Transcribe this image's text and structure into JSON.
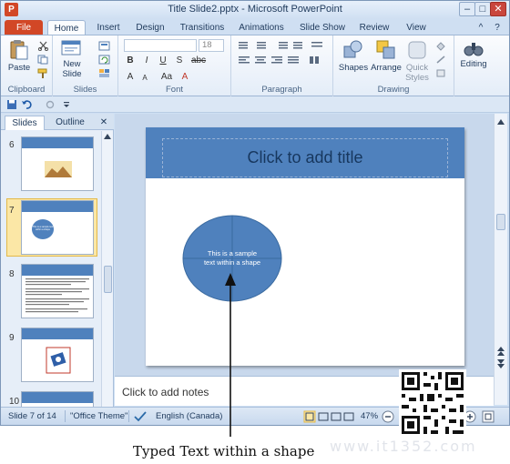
{
  "window": {
    "title": "Title Slide2.pptx - Microsoft PowerPoint",
    "app_icon": "P"
  },
  "window_controls": {
    "minimize": "–",
    "maximize": "□",
    "close": "✕"
  },
  "ribbon_tabs": {
    "file": "File",
    "home": "Home",
    "insert": "Insert",
    "design": "Design",
    "transitions": "Transitions",
    "animations": "Animations",
    "slide_show": "Slide Show",
    "review": "Review",
    "view": "View",
    "minimize_ribbon": "^",
    "help": "?"
  },
  "ribbon": {
    "clipboard": {
      "label": "Clipboard",
      "paste": "Paste"
    },
    "slides": {
      "label": "Slides",
      "new_slide_line1": "New",
      "new_slide_line2": "Slide"
    },
    "font": {
      "label": "Font",
      "size": "18",
      "bold": "B",
      "italic": "I",
      "underline": "U",
      "strike": "S",
      "shadow": "abc",
      "grow": "A",
      "shrink": "A",
      "case": "Aa",
      "color": "A"
    },
    "paragraph": {
      "label": "Paragraph"
    },
    "drawing": {
      "label": "Drawing",
      "shapes": "Shapes",
      "arrange": "Arrange",
      "quick_styles_line1": "Quick",
      "quick_styles_line2": "Styles"
    },
    "editing": {
      "label": "Editing"
    }
  },
  "slides_panel": {
    "tabs": {
      "slides": "Slides",
      "outline": "Outline",
      "close": "✕"
    },
    "thumbnails": [
      {
        "number": "6"
      },
      {
        "number": "7",
        "text": "This is a sample text within a shape"
      },
      {
        "number": "8"
      },
      {
        "number": "9"
      },
      {
        "number": "10"
      }
    ]
  },
  "slide": {
    "title_placeholder": "Click to add title",
    "shape_text_line1": "This is a sample",
    "shape_text_line2": "text within a shape"
  },
  "notes": {
    "placeholder": "Click to add notes"
  },
  "status_bar": {
    "slide_position": "Slide 7 of 14",
    "theme": "\"Office Theme\"",
    "language": "English (Canada)",
    "zoom": "47%"
  },
  "caption": "Typed Text within a shape",
  "watermark": "www.it1352.com",
  "colors": {
    "file_tab": "#d24726",
    "slide_band": "#4f81bd",
    "shape_fill": "#4f81bd",
    "selected_thumb": "#fbe7a6"
  }
}
